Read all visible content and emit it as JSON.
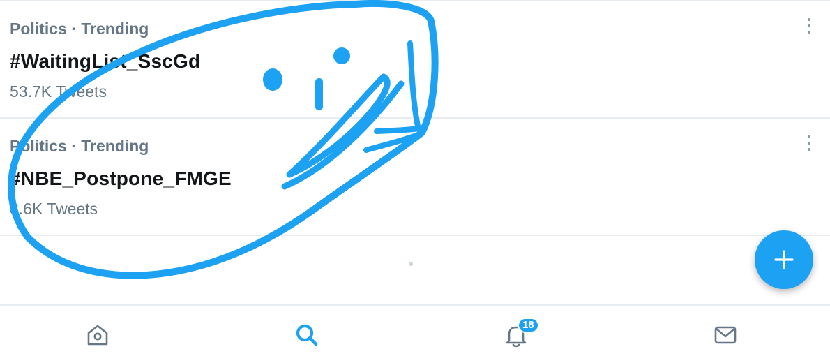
{
  "trends": [
    {
      "meta": "Politics · Trending",
      "title": "#WaitingList_SscGd",
      "count": "53.7K Tweets"
    },
    {
      "meta": "Politics · Trending",
      "title": "#NBE_Postpone_FMGE",
      "count": "8.6K Tweets"
    }
  ],
  "tabbar": {
    "active_tab": "search",
    "notifications_badge": "18",
    "icons": [
      "home-icon",
      "search-icon",
      "bell-icon",
      "mail-icon"
    ]
  },
  "fab": {
    "icon": "plus-icon"
  },
  "colors": {
    "accent": "#1da1f2",
    "text_primary": "#14171a",
    "text_secondary": "#657786",
    "divider": "#e6ecf0",
    "icon_inactive": "#657786",
    "scribble": "#1da1f2"
  }
}
